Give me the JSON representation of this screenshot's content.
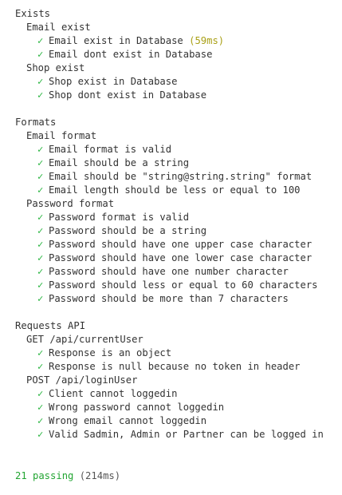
{
  "suites": [
    {
      "title": "Exists",
      "groups": [
        {
          "title": "Email exist",
          "tests": [
            {
              "title": "Email exist in Database",
              "duration": "(59ms)"
            },
            {
              "title": "Email dont exist in Database"
            }
          ]
        },
        {
          "title": "Shop exist",
          "tests": [
            {
              "title": "Shop exist in Database"
            },
            {
              "title": "Shop dont exist in Database"
            }
          ]
        }
      ]
    },
    {
      "title": "Formats",
      "groups": [
        {
          "title": "Email format",
          "tests": [
            {
              "title": "Email format is valid"
            },
            {
              "title": "Email should be a string"
            },
            {
              "title": "Email should be \"string@string.string\" format"
            },
            {
              "title": "Email length should be less or equal to 100"
            }
          ]
        },
        {
          "title": "Password format",
          "tests": [
            {
              "title": "Password format is valid"
            },
            {
              "title": "Password should be a string"
            },
            {
              "title": "Password should have one upper case character"
            },
            {
              "title": "Password should have one lower case character"
            },
            {
              "title": "Password should have one number character"
            },
            {
              "title": "Password should less or equal to 60 characters"
            },
            {
              "title": "Password should be more than 7 characters"
            }
          ]
        }
      ]
    },
    {
      "title": "Requests API",
      "groups": [
        {
          "title": "GET /api/currentUser",
          "tests": [
            {
              "title": "Response is an object"
            },
            {
              "title": "Response is null because no token in header"
            }
          ]
        },
        {
          "title": "POST /api/loginUser",
          "tests": [
            {
              "title": "Client cannot loggedin"
            },
            {
              "title": "Wrong password cannot loggedin"
            },
            {
              "title": "Wrong email cannot loggedin"
            },
            {
              "title": "Valid Sadmin, Admin or Partner can be logged in"
            }
          ]
        }
      ]
    }
  ],
  "check_glyph": "✓",
  "summary": {
    "passing": "21 passing",
    "duration": "(214ms)"
  },
  "colors": {
    "check": "#22b33a",
    "slow_duration": "#a9a016",
    "passing": "#22a532",
    "text": "#333333"
  }
}
